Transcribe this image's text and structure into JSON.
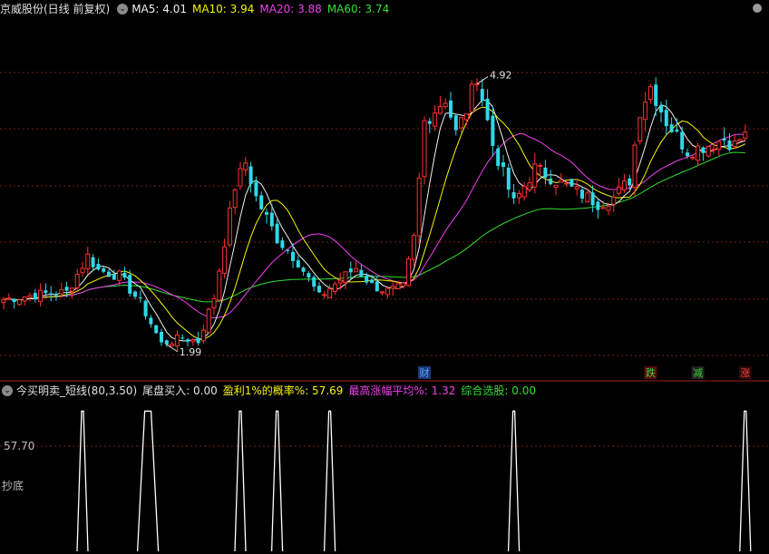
{
  "header": {
    "title": "京威股份(日线 前复权)",
    "ma": [
      {
        "label": "MA5: 4.01",
        "color": "#f0f0f0"
      },
      {
        "label": "MA10: 3.94",
        "color": "#f5f500"
      },
      {
        "label": "MA20: 3.88",
        "color": "#f040f0"
      },
      {
        "label": "MA60: 3.74",
        "color": "#30e030"
      }
    ]
  },
  "price_panel": {
    "max_label": "4.92",
    "min_label": "1.99",
    "markers": [
      {
        "label": "财",
        "color": "#5aa0ff",
        "bg": "#1a3a7a"
      },
      {
        "label": "跌",
        "color": "#3ad03a",
        "bg": "#5a0a0a"
      },
      {
        "label": "减",
        "color": "#3ad03a",
        "bg": "#222222"
      },
      {
        "label": "涨",
        "color": "#ff4040",
        "bg": "#2a0a0a"
      }
    ]
  },
  "indicator_panel": {
    "name": "今买明卖_短线(80,3.50)",
    "items": [
      {
        "label": "尾盘买入: 0.00",
        "color": "#f0f0f0"
      },
      {
        "label": "盈利1%的概率%: 57.69",
        "color": "#f5f500"
      },
      {
        "label": "最高涨幅平均%: 1.32",
        "color": "#f040f0"
      },
      {
        "label": "综合选股: 0.00",
        "color": "#30e030"
      }
    ],
    "level_label": "57.70",
    "side_label": "抄底"
  },
  "chart_data": [
    {
      "type": "candlestick",
      "title": "京威股份(日线 前复权)",
      "y_range": [
        1.9,
        5.0
      ],
      "ma_latest": {
        "MA5": 4.01,
        "MA10": 3.94,
        "MA20": 3.88,
        "MA60": 3.74
      },
      "annotations": {
        "high": 4.92,
        "low": 1.99
      },
      "anchors": [
        {
          "i": 0,
          "c": 2.58
        },
        {
          "i": 6,
          "c": 2.62
        },
        {
          "i": 12,
          "c": 2.64
        },
        {
          "i": 16,
          "c": 2.95
        },
        {
          "i": 18,
          "c": 2.83
        },
        {
          "i": 22,
          "c": 2.78
        },
        {
          "i": 26,
          "c": 2.55
        },
        {
          "i": 30,
          "c": 2.2
        },
        {
          "i": 34,
          "c": 2.25
        },
        {
          "i": 37,
          "c": 2.22
        },
        {
          "i": 40,
          "c": 2.6
        },
        {
          "i": 44,
          "c": 3.55
        },
        {
          "i": 46,
          "c": 3.75
        },
        {
          "i": 48,
          "c": 3.45
        },
        {
          "i": 52,
          "c": 3.1
        },
        {
          "i": 56,
          "c": 2.9
        },
        {
          "i": 60,
          "c": 2.6
        },
        {
          "i": 64,
          "c": 2.75
        },
        {
          "i": 67,
          "c": 2.85
        },
        {
          "i": 70,
          "c": 2.7
        },
        {
          "i": 73,
          "c": 2.65
        },
        {
          "i": 76,
          "c": 2.68
        },
        {
          "i": 78,
          "c": 3.1
        },
        {
          "i": 80,
          "c": 4.1
        },
        {
          "i": 84,
          "c": 4.3
        },
        {
          "i": 86,
          "c": 4.0
        },
        {
          "i": 88,
          "c": 4.2
        },
        {
          "i": 90,
          "c": 4.5
        },
        {
          "i": 93,
          "c": 3.9
        },
        {
          "i": 97,
          "c": 3.4
        },
        {
          "i": 101,
          "c": 3.7
        },
        {
          "i": 105,
          "c": 3.6
        },
        {
          "i": 109,
          "c": 3.5
        },
        {
          "i": 113,
          "c": 3.4
        },
        {
          "i": 116,
          "c": 3.45
        },
        {
          "i": 119,
          "c": 3.6
        },
        {
          "i": 121,
          "c": 4.2
        },
        {
          "i": 123,
          "c": 4.4
        },
        {
          "i": 126,
          "c": 4.1
        },
        {
          "i": 130,
          "c": 3.85
        },
        {
          "i": 134,
          "c": 3.9
        },
        {
          "i": 137,
          "c": 3.95
        },
        {
          "i": 139,
          "c": 3.9
        },
        {
          "i": 141,
          "c": 4.01
        }
      ]
    },
    {
      "type": "line",
      "title": "今买明卖_短线(80,3.50)",
      "ylim": [
        0,
        100
      ],
      "spikes": [
        {
          "i": 15,
          "w": 1,
          "v": 92
        },
        {
          "i": 27,
          "w": 2,
          "v": 92
        },
        {
          "i": 45,
          "w": 1,
          "v": 92
        },
        {
          "i": 52,
          "w": 1,
          "v": 92
        },
        {
          "i": 62,
          "w": 1,
          "v": 92
        },
        {
          "i": 97,
          "w": 1,
          "v": 92
        },
        {
          "i": 141,
          "w": 1,
          "v": 92
        }
      ]
    }
  ]
}
